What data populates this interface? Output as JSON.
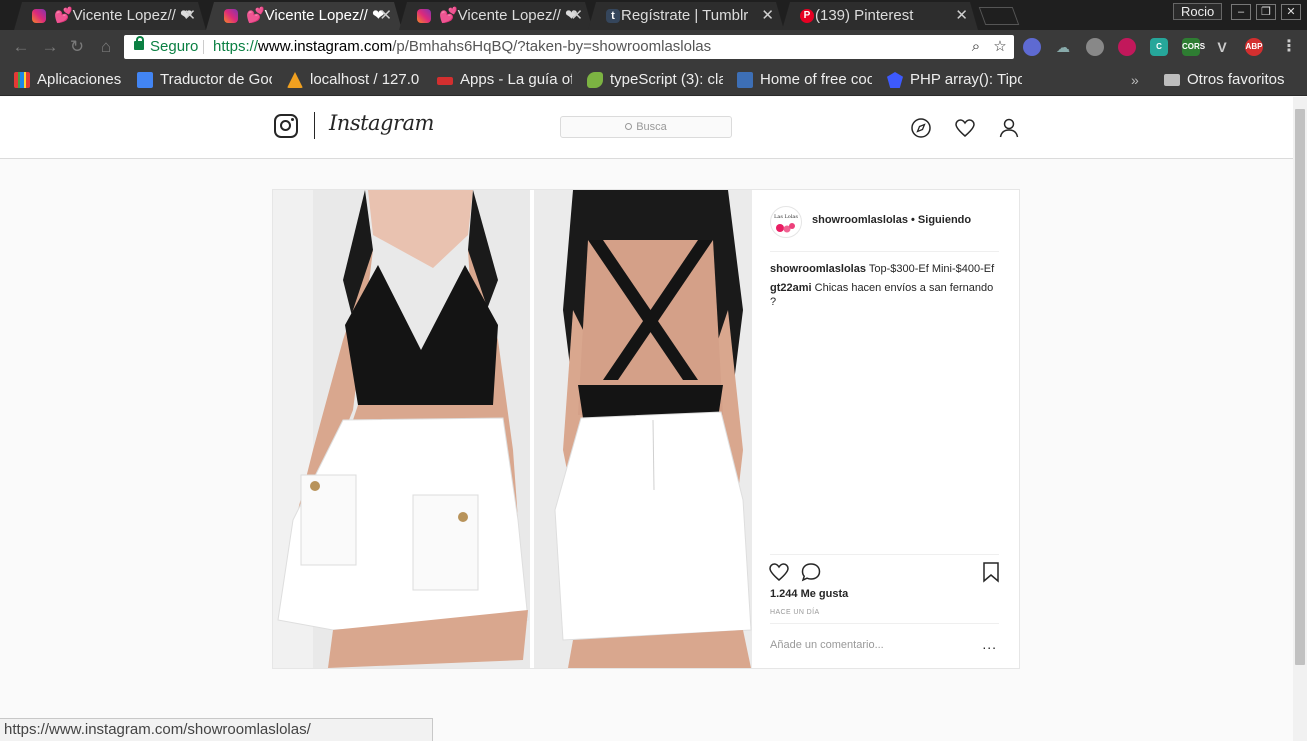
{
  "browser": {
    "tabs": [
      {
        "title": "💕Vicente Lopez// ❤",
        "favicon": "instagram-favicon",
        "active": false
      },
      {
        "title": "💕Vicente Lopez// ❤",
        "favicon": "instagram-favicon",
        "active": true
      },
      {
        "title": "💕Vicente Lopez// ❤",
        "favicon": "instagram-favicon",
        "active": false
      },
      {
        "title": "Regístrate | Tumblr",
        "favicon": "tumblr-favicon",
        "active": false
      },
      {
        "title": "(139) Pinterest",
        "favicon": "pinterest-favicon",
        "active": false
      }
    ],
    "tab_close_glyph": "✕",
    "profile_name": "Rocio",
    "window_controls": [
      "–",
      "❐",
      "✕"
    ],
    "omnibox": {
      "secure_label": "Seguro",
      "url_scheme": "https://",
      "url_host": "www.instagram.com",
      "url_path": "/p/Bmhahs6HqBQ/?taken-by=showroomlaslolas"
    },
    "bookmarks": [
      {
        "label": "Aplicaciones",
        "icon": "apps-grid-icon",
        "color": "#e64a19"
      },
      {
        "label": "Traductor de Goo",
        "icon": "google-translate-icon",
        "color": "#4285f4"
      },
      {
        "label": "localhost / 127.0",
        "icon": "phpmyadmin-icon",
        "color": "#f0a020"
      },
      {
        "label": "Apps - La guía of",
        "icon": "apps-guide-icon",
        "color": "#d32f2f"
      },
      {
        "label": "typeScript (3): cla",
        "icon": "typescript-icon",
        "color": "#7cb342"
      },
      {
        "label": "Home of free coo",
        "icon": "code-home-icon",
        "color": "#3d6fb6"
      },
      {
        "label": "PHP array(): Tipo",
        "icon": "php-icon",
        "color": "#3d5afe"
      }
    ],
    "other_bookmarks": "Otros favoritos",
    "status_url": "https://www.instagram.com/showroomlaslolas/"
  },
  "instagram": {
    "wordmark": "Instagram",
    "search_placeholder": "Busca",
    "post": {
      "owner": "showroomlaslolas",
      "following_label": "Siguiendo",
      "header_line": "showroomlaslolas • Siguiendo",
      "comments": [
        {
          "user": "showroomlaslolas",
          "text": "Top-$300-Ef Mini-$400-Ef"
        },
        {
          "user": "gt22ami",
          "text": "Chicas hacen envíos a san fernando ?"
        }
      ],
      "likes": "1.244 Me gusta",
      "age": "HACE UN DÍA",
      "add_comment_placeholder": "Añade un comentario...",
      "more_options": "..."
    }
  },
  "colors": {
    "secure_green": "#0b8043",
    "ig_text": "#262626",
    "ig_border": "#dbdbdb"
  }
}
